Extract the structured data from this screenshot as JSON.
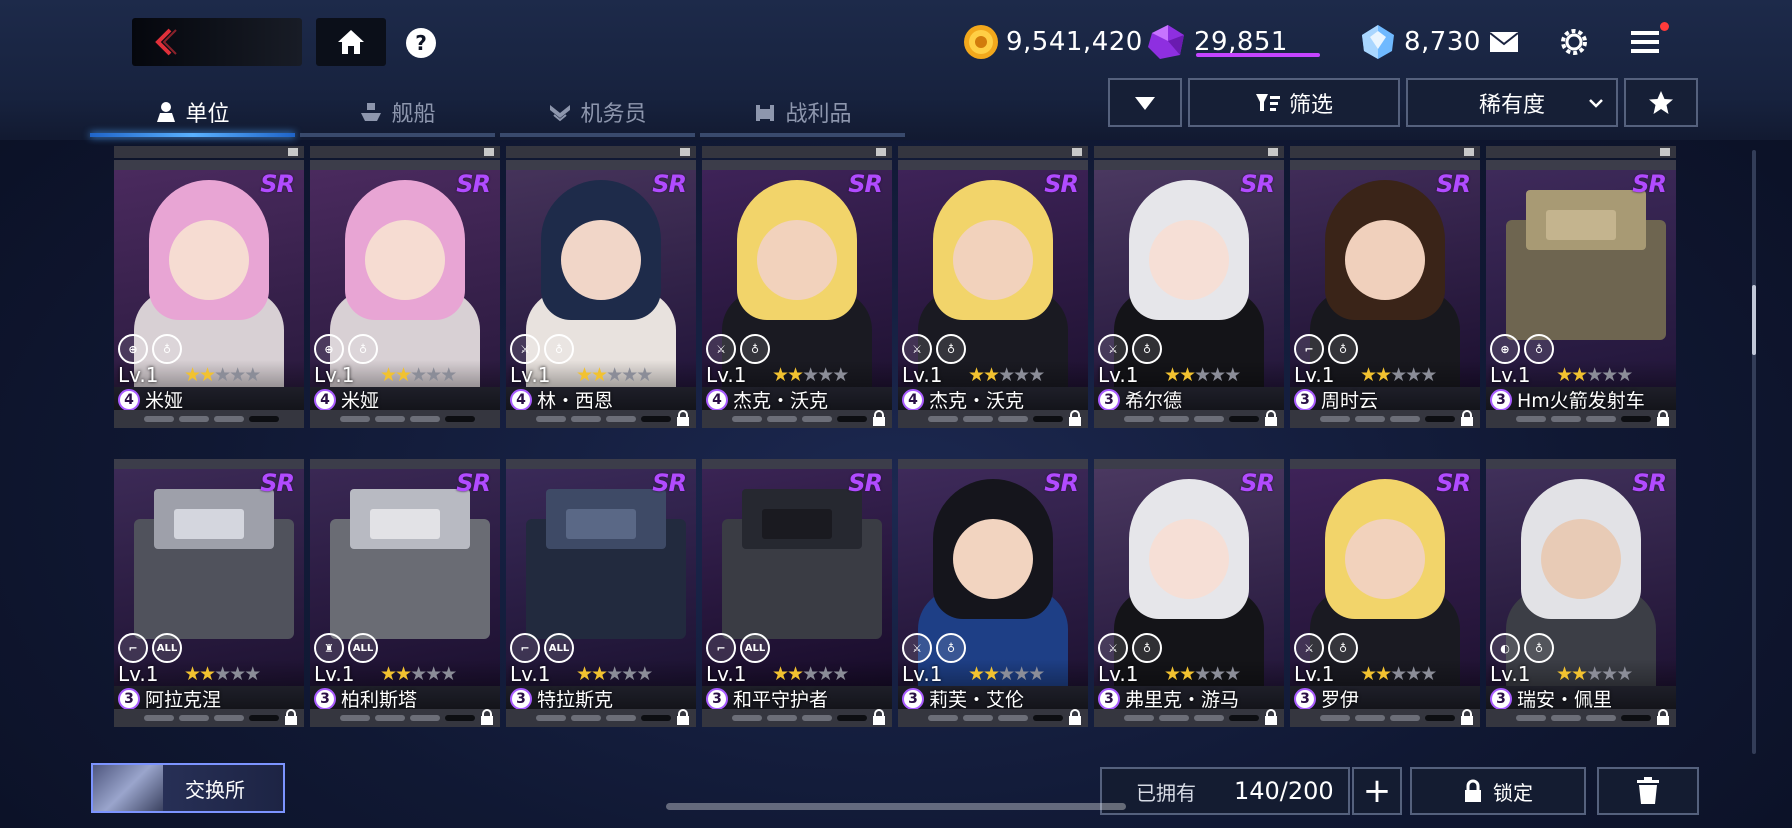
{
  "currencies": {
    "gold": "9,541,420",
    "purple": "29,851",
    "crystal": "8,730"
  },
  "tabs": [
    {
      "label": "单位",
      "icon": "unit-icon",
      "active": true
    },
    {
      "label": "舰船",
      "icon": "ship-icon",
      "active": false
    },
    {
      "label": "机务员",
      "icon": "operator-icon",
      "active": false
    },
    {
      "label": "战利品",
      "icon": "loot-icon",
      "active": false
    }
  ],
  "toolbar": {
    "filter_label": "筛选",
    "sort_label": "稀有度"
  },
  "rarity_label": "SR",
  "level_label": "Lv.1",
  "all_label": "ALL",
  "colors": {
    "rarity": "#b14bff",
    "star_on": "#f2c230",
    "tab_active": "#4ca5ff",
    "notification": "#ff3b3b"
  },
  "cards": [
    {
      "name": "米娅",
      "cost": "4",
      "stars": 2,
      "roles": [
        "target-icon",
        "shield-wing-icon"
      ],
      "locked": false,
      "art": "pink"
    },
    {
      "name": "米娅",
      "cost": "4",
      "stars": 2,
      "roles": [
        "target-icon",
        "shield-wing-icon"
      ],
      "locked": false,
      "art": "pink"
    },
    {
      "name": "林・西恩",
      "cost": "4",
      "stars": 2,
      "roles": [
        "crossed-swords-icon",
        "shield-wing-icon"
      ],
      "locked": true,
      "art": "navy"
    },
    {
      "name": "杰克・沃克",
      "cost": "4",
      "stars": 2,
      "roles": [
        "crossed-swords-icon",
        "shield-wing-icon"
      ],
      "locked": true,
      "art": "blond"
    },
    {
      "name": "杰克・沃克",
      "cost": "4",
      "stars": 2,
      "roles": [
        "crossed-swords-icon",
        "shield-wing-icon"
      ],
      "locked": true,
      "art": "blond"
    },
    {
      "name": "希尔德",
      "cost": "3",
      "stars": 2,
      "roles": [
        "crossed-swords-icon",
        "shield-wing-icon"
      ],
      "locked": true,
      "art": "white"
    },
    {
      "name": "周时云",
      "cost": "3",
      "stars": 2,
      "roles": [
        "rifle-icon",
        "shield-wing-icon"
      ],
      "locked": true,
      "art": "dark"
    },
    {
      "name": "Hm火箭发射车",
      "cost": "3",
      "stars": 2,
      "roles": [
        "target-icon",
        "shield-wing-icon"
      ],
      "locked": true,
      "art": "truck"
    },
    {
      "name": "阿拉克涅",
      "cost": "3",
      "stars": 2,
      "roles": [
        "rifle-icon",
        "all-icon"
      ],
      "locked": true,
      "art": "mech"
    },
    {
      "name": "柏利斯塔",
      "cost": "3",
      "stars": 2,
      "roles": [
        "chess-icon",
        "all-icon"
      ],
      "locked": true,
      "art": "turret"
    },
    {
      "name": "特拉斯克",
      "cost": "3",
      "stars": 2,
      "roles": [
        "rifle-icon",
        "all-icon"
      ],
      "locked": true,
      "art": "ship"
    },
    {
      "name": "和平守护者",
      "cost": "3",
      "stars": 2,
      "roles": [
        "rifle-icon",
        "all-icon"
      ],
      "locked": true,
      "art": "robot"
    },
    {
      "name": "莉芙・艾伦",
      "cost": "3",
      "stars": 2,
      "roles": [
        "crossed-swords-icon",
        "shield-wing-icon"
      ],
      "locked": true,
      "art": "blue"
    },
    {
      "name": "弗里克・游马",
      "cost": "3",
      "stars": 2,
      "roles": [
        "crossed-swords-icon",
        "shield-wing-icon"
      ],
      "locked": true,
      "art": "white"
    },
    {
      "name": "罗伊",
      "cost": "3",
      "stars": 2,
      "roles": [
        "crossed-swords-icon",
        "shield-wing-icon"
      ],
      "locked": true,
      "art": "blond"
    },
    {
      "name": "瑞安・佩里",
      "cost": "3",
      "stars": 2,
      "roles": [
        "shield-icon",
        "shield-wing-icon"
      ],
      "locked": true,
      "art": "silver"
    }
  ],
  "footer": {
    "exchange_label": "交换所",
    "owned_label": "已拥有",
    "owned_count": "140/200",
    "lock_label": "锁定"
  }
}
